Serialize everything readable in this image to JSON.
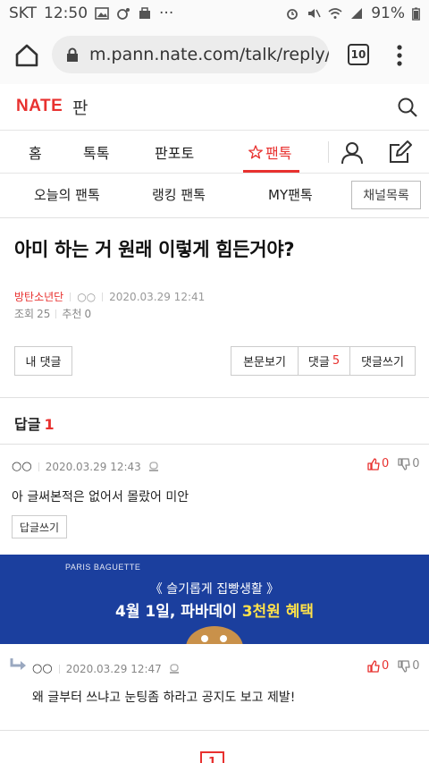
{
  "status_bar": {
    "carrier": "SKT",
    "time": "12:50",
    "extra_dots": "···",
    "battery": "91%"
  },
  "browser": {
    "url": "m.pann.nate.com/talk/reply/su",
    "tab_count": "10"
  },
  "site": {
    "logo": "NATE",
    "logo_sub": "판",
    "brand_color": "#e8312f"
  },
  "main_nav": {
    "items": [
      "홈",
      "톡톡",
      "판포토",
      "팬톡"
    ],
    "active_index": 3
  },
  "sub_nav": {
    "items": [
      "오늘의 팬톡",
      "랭킹 팬톡",
      "MY팬톡"
    ],
    "channel_button": "채널목록"
  },
  "post": {
    "title": "아미 하는 거 원래 이렇게 힘든거야?",
    "author": "방탄소년단",
    "nickname": "○○",
    "datetime": "2020.03.29 12:41",
    "views_label": "조회",
    "views": "25",
    "recommend_label": "추천",
    "recommend": "0"
  },
  "actions": {
    "my_comments": "내 댓글",
    "view_body": "본문보기",
    "comments_label": "댓글",
    "comments_count": "5",
    "write_comment": "댓글쓰기"
  },
  "replies": {
    "header_label": "답글",
    "header_count": "1"
  },
  "comments": [
    {
      "nick": "○○",
      "datetime": "2020.03.29 12:43",
      "body": "아 글써본적은 없어서 몰랐어 미안",
      "up": "0",
      "down": "0",
      "reply_button": "답글쓰기"
    },
    {
      "nick": "○○",
      "datetime": "2020.03.29 12:47",
      "body": "왜 글부터 쓰냐고 눈팅좀 하라고 공지도 보고 제발!",
      "up": "0",
      "down": "0"
    }
  ],
  "ad": {
    "brand": "PARIS BAGUETTE",
    "line1": "《 슬기롭게 집빵생활 》",
    "line2_prefix": "4월 1일, 파바데이 ",
    "line2_highlight": "3천원 혜택",
    "background": "#1b3f9e"
  },
  "pagination": {
    "current": "1"
  }
}
